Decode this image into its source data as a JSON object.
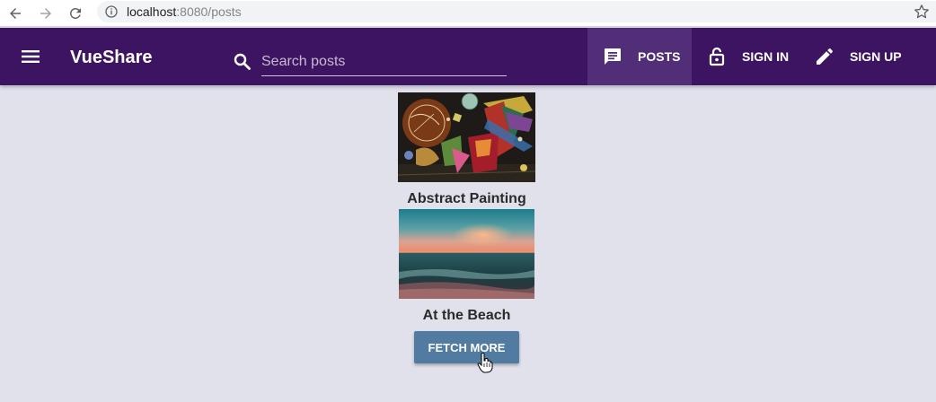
{
  "browser": {
    "url_host": "localhost",
    "url_path": ":8080/posts"
  },
  "app": {
    "brand": "VueShare",
    "search_placeholder": "Search posts",
    "nav": {
      "posts": "POSTS",
      "sign_in": "SIGN IN",
      "sign_up": "SIGN UP"
    }
  },
  "posts": [
    {
      "title": "Abstract Painting"
    },
    {
      "title": "At the Beach"
    }
  ],
  "fetch_more_label": "FETCH MORE",
  "colors": {
    "toolbar": "#3d1461",
    "active_nav": "#522d78",
    "page_bg": "#e1e1ec",
    "button": "#527ba1"
  }
}
